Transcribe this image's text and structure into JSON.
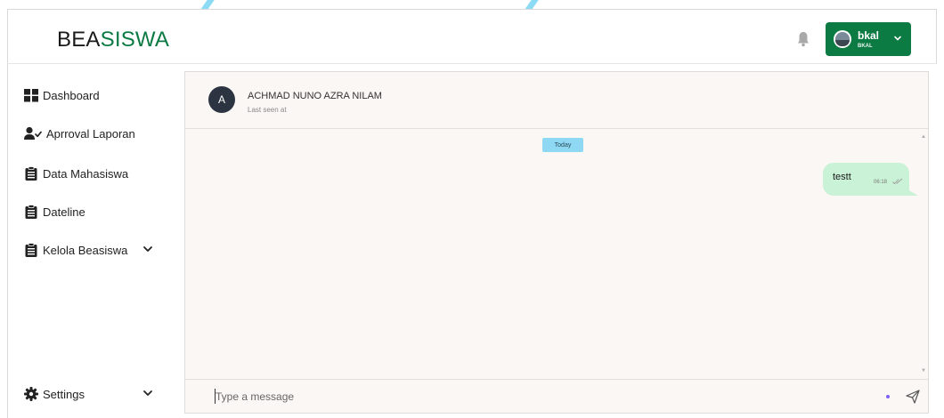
{
  "header": {
    "brand_part1": "BEA",
    "brand_part2": "SISWA",
    "user": {
      "name": "bkal",
      "role": "BKAL"
    }
  },
  "sidebar": {
    "items": [
      {
        "label": "Dashboard",
        "icon": "dashboard-grid-icon"
      },
      {
        "label": "Aprroval Laporan",
        "icon": "user-check-icon"
      },
      {
        "label": "Data Mahasiswa",
        "icon": "clipboard-list-icon"
      },
      {
        "label": "Dateline",
        "icon": "clipboard-list-icon"
      },
      {
        "label": "Kelola Beasiswa",
        "icon": "clipboard-list-icon",
        "has_dropdown": true
      }
    ],
    "settings": {
      "label": "Settings",
      "icon": "gear-icon",
      "has_dropdown": true
    }
  },
  "chat": {
    "contact": {
      "initial": "A",
      "name": "ACHMAD NUNO AZRA NILAM",
      "status": "Last seen at"
    },
    "date_divider": "Today",
    "messages": [
      {
        "text": "testt",
        "time": "06:18",
        "direction": "outgoing",
        "read": true
      }
    ],
    "composer": {
      "placeholder": "Type a message",
      "value": ""
    }
  },
  "colors": {
    "brand_green": "#0c7a43",
    "outgoing_bubble": "#c9f2d6",
    "date_pill": "#8ed8f4",
    "chat_background": "#faf7f4"
  }
}
